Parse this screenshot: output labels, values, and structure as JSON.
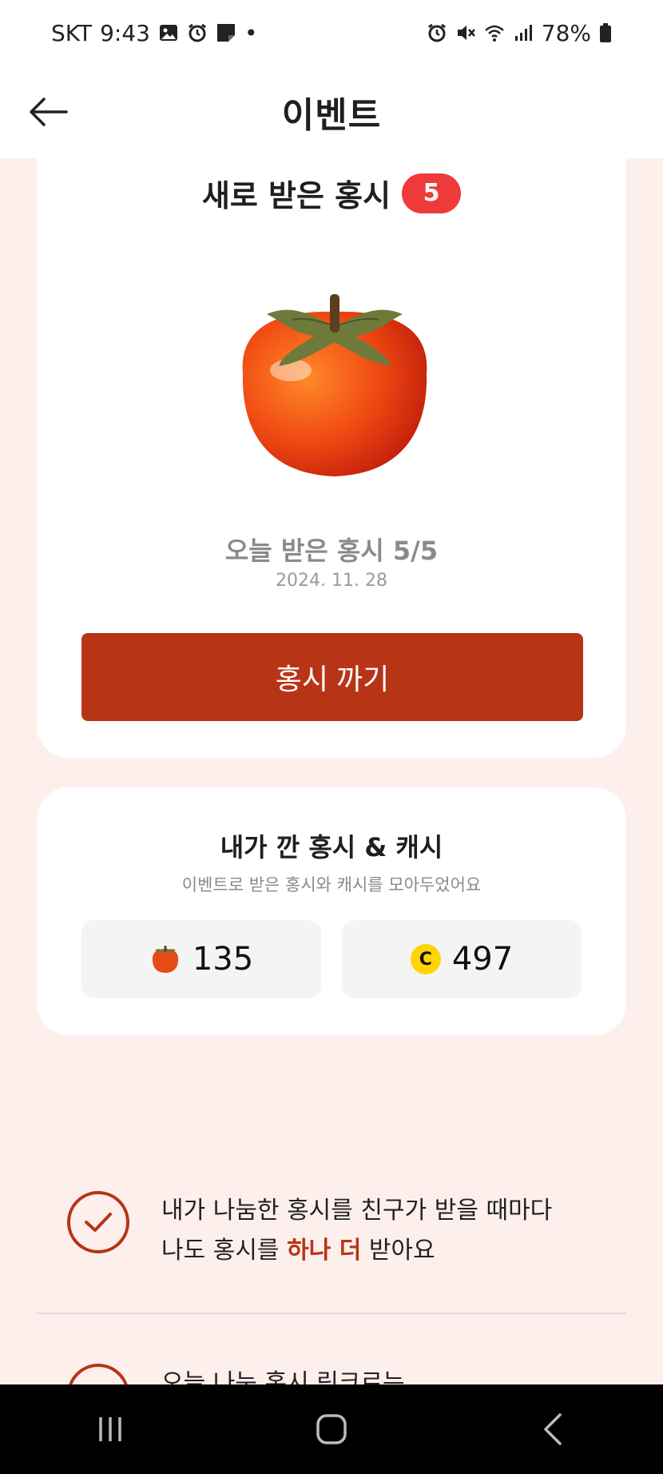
{
  "status_bar": {
    "carrier": "SKT",
    "time": "9:43",
    "dot": "•",
    "battery": "78%"
  },
  "header": {
    "title": "이벤트"
  },
  "new_persimmons": {
    "title": "새로 받은 홍시",
    "badge_count": "5",
    "today_label": "오늘 받은 홍시 5/5",
    "date": "2024. 11. 28",
    "button_label": "홍시 까기"
  },
  "collection": {
    "title": "내가 깐 홍시 & 캐시",
    "subtitle": "이벤트로 받은 홍시와 캐시를 모아두었어요",
    "persimmon_count": "135",
    "cash_icon_letter": "C",
    "cash_count": "497"
  },
  "benefits": [
    {
      "line1": "내가 나눔한 홍시를 친구가 받을 때마다",
      "line2_prefix": "나도 홍시를 ",
      "line2_highlight": "하나 더",
      "line2_suffix": " 받아요"
    },
    {
      "line1": "오늘 나눈 홍시 링크로는"
    }
  ],
  "colors": {
    "accent": "#b83416",
    "badge": "#ef3a3a",
    "page_bg": "#fdf0ec",
    "coin": "#ffd400"
  }
}
